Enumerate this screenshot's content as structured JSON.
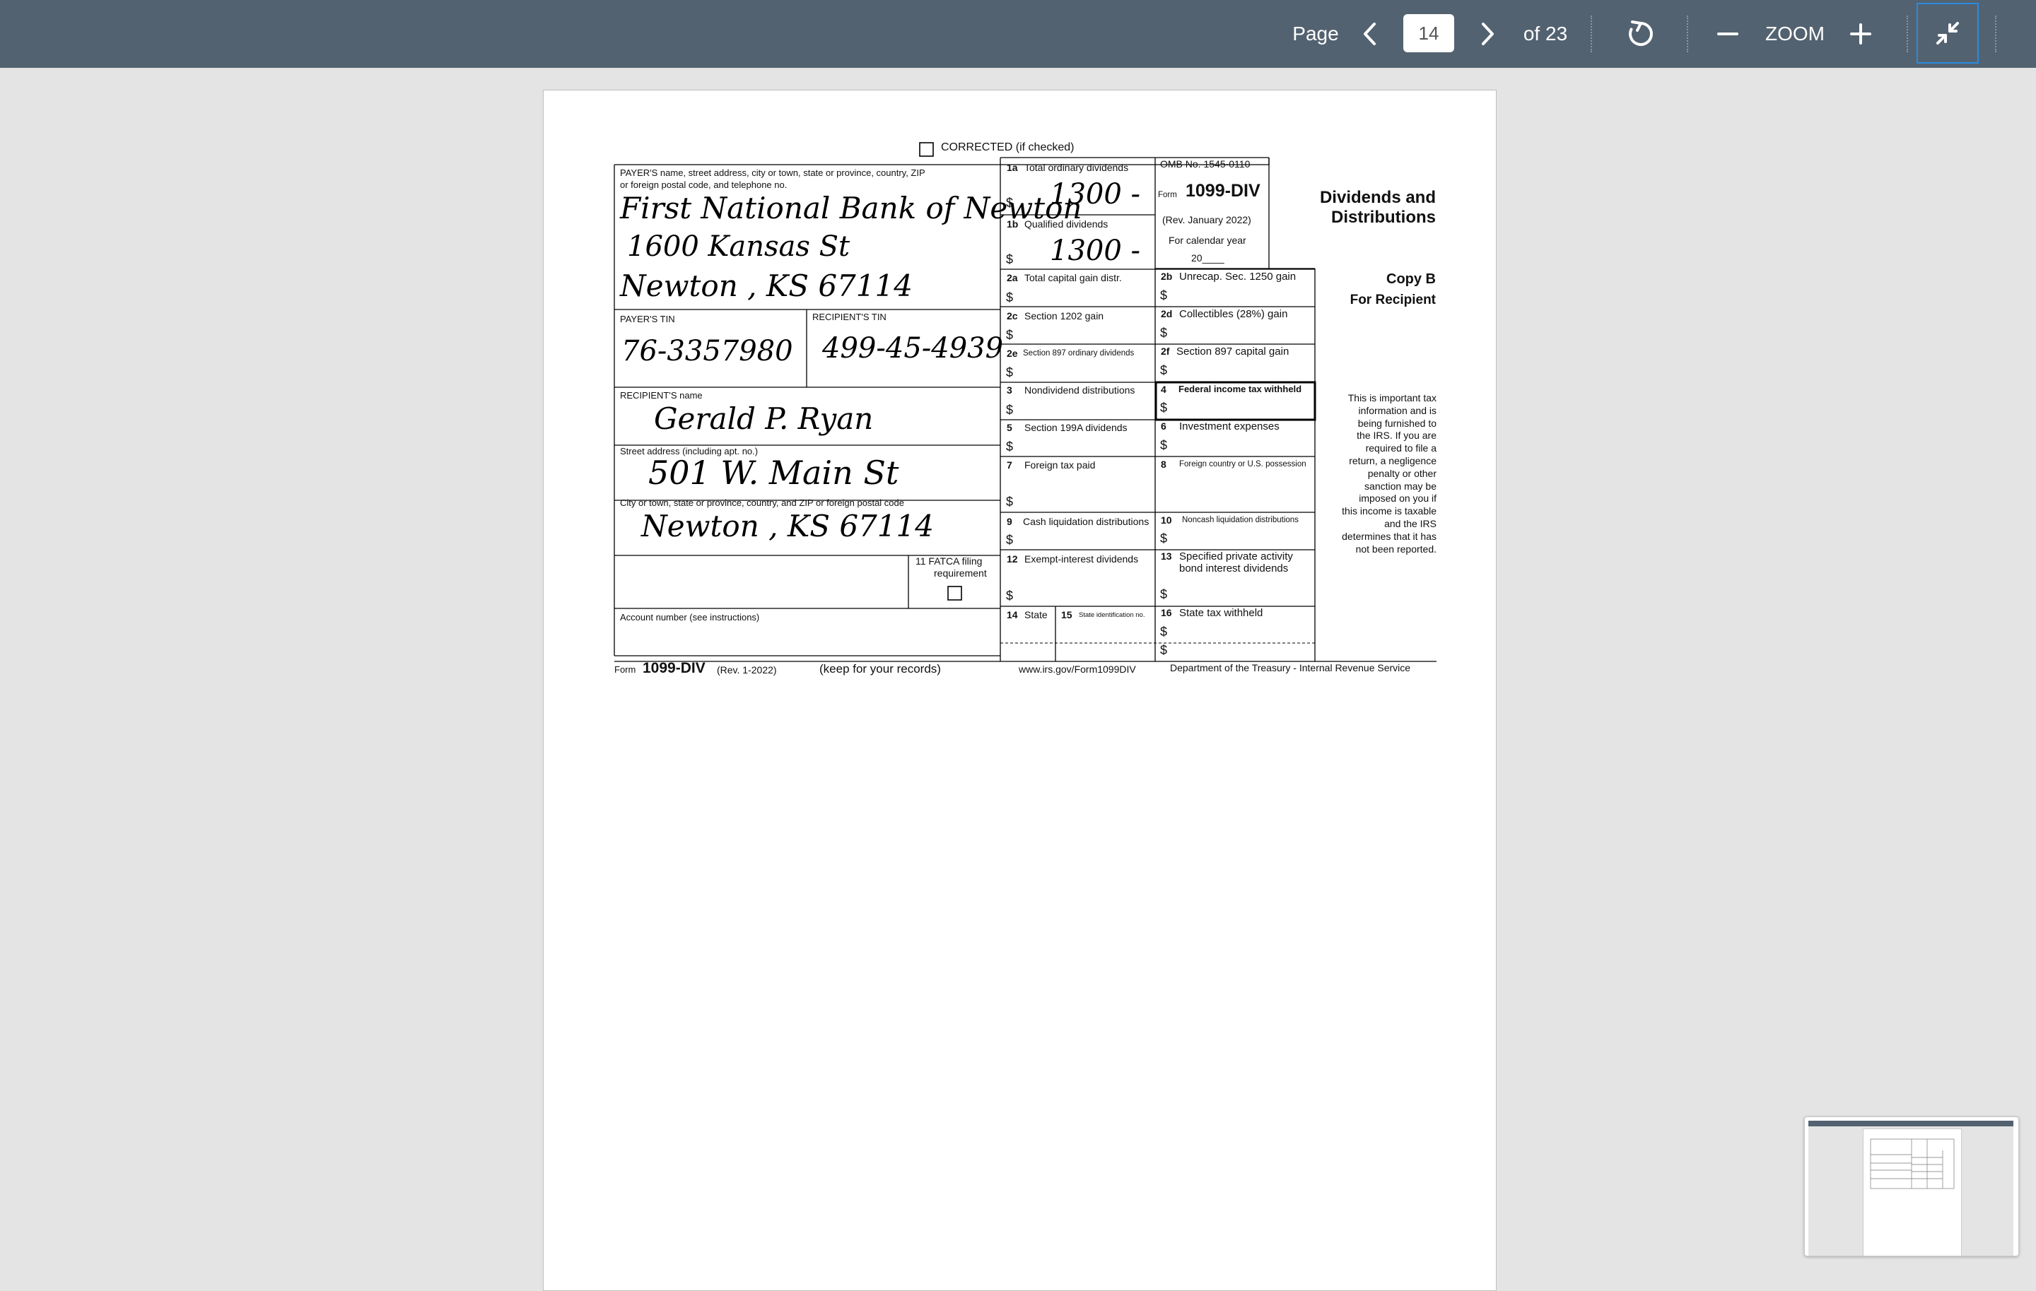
{
  "toolbar": {
    "page_label": "Page",
    "current_page": "14",
    "of_pages": "of 23",
    "zoom_label": "ZOOM",
    "icons": [
      "chevron-left-icon",
      "chevron-right-icon",
      "rotate-icon",
      "minus-icon",
      "plus-icon",
      "exit-fullscreen-icon"
    ]
  },
  "form": {
    "corrected": "CORRECTED (if checked)",
    "payer_label_1": "PAYER'S name, street address, city or town, state or province, country, ZIP",
    "payer_label_2": "or foreign postal code, and telephone no.",
    "payer_name": "First National Bank of Newton",
    "payer_street": "1600 Kansas St",
    "payer_city": "Newton , KS 67114",
    "payer_tin_label": "PAYER'S TIN",
    "recipient_tin_label": "RECIPIENT'S TIN",
    "payer_tin": "76-3357980",
    "recipient_tin": "499-45-4939",
    "recipient_name_label": "RECIPIENT'S name",
    "recipient_name": "Gerald P. Ryan",
    "street_label": "Street address (including apt. no.)",
    "street": "501 W. Main St",
    "city_label": "City or town, state or province, country, and ZIP or foreign postal code",
    "city": "Newton , KS 67114",
    "fatca_1": "11 FATCA filing",
    "fatca_2": "requirement",
    "account_label": "Account number (see instructions)",
    "box_1a_num": "1a",
    "box_1a": "Total ordinary dividends",
    "box_1a_value": "1300 -",
    "box_1b_num": "1b",
    "box_1b": "Qualified dividends",
    "box_1b_value": "1300 -",
    "omb": "OMB No. 1545-0110",
    "form_word": "Form",
    "form_name": "1099-DIV",
    "rev": "(Rev. January 2022)",
    "cal_year": "For calendar year",
    "cal_year_20": "20____",
    "title_1": "Dividends and",
    "title_2": "Distributions",
    "copy_b": "Copy B",
    "for_recipient": "For Recipient",
    "box_2a_num": "2a",
    "box_2a": "Total capital gain distr.",
    "box_2b_num": "2b",
    "box_2b": "Unrecap. Sec. 1250 gain",
    "box_2c_num": "2c",
    "box_2c": "Section 1202 gain",
    "box_2d_num": "2d",
    "box_2d": "Collectibles (28%) gain",
    "box_2e_num": "2e",
    "box_2e": "Section 897 ordinary dividends",
    "box_2f_num": "2f",
    "box_2f": "Section 897 capital gain",
    "box_3_num": "3",
    "box_3": "Nondividend distributions",
    "box_4_num": "4",
    "box_4": "Federal income tax withheld",
    "box_5_num": "5",
    "box_5": "Section 199A dividends",
    "box_6_num": "6",
    "box_6": "Investment expenses",
    "box_7_num": "7",
    "box_7": "Foreign tax paid",
    "box_8_num": "8",
    "box_8": "Foreign country or U.S. possession",
    "box_9_num": "9",
    "box_9": "Cash liquidation distributions",
    "box_10_num": "10",
    "box_10": "Noncash liquidation distributions",
    "box_12_num": "12",
    "box_12": "Exempt-interest dividends",
    "box_13_num": "13",
    "box_13a": "Specified private activity",
    "box_13b": "bond interest dividends",
    "box_14_num": "14",
    "box_14": "State",
    "box_15_num": "15",
    "box_15": "State identification no.",
    "box_16_num": "16",
    "box_16": "State tax withheld",
    "dollar": "$",
    "notice": [
      "This is important tax",
      "information and is",
      "being furnished to",
      "the IRS. If you are",
      "required to file a",
      "return, a negligence",
      "penalty or other",
      "sanction may be",
      "imposed on you if",
      "this income is taxable",
      "and the IRS",
      "determines that it has",
      "not been reported."
    ],
    "footer_form": "Form",
    "footer_name": "1099-DIV",
    "footer_rev": "(Rev. 1-2022)",
    "footer_keep": "(keep for your records)",
    "footer_url": "www.irs.gov/Form1099DIV",
    "footer_dept": "Department of the Treasury - Internal Revenue Service"
  }
}
